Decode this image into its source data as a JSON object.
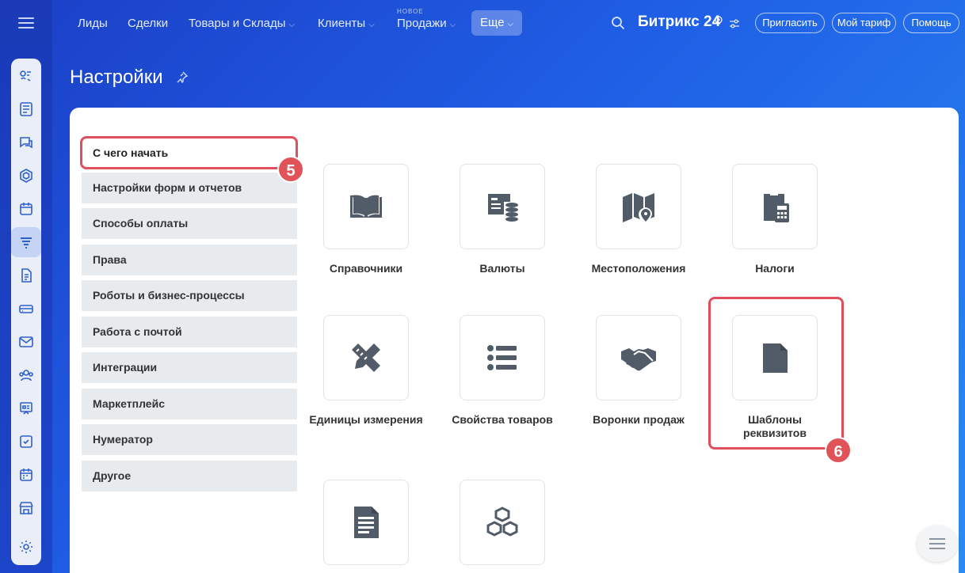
{
  "topnav": {
    "items": [
      {
        "label": "Лиды",
        "chevron": false
      },
      {
        "label": "Сделки",
        "chevron": false
      },
      {
        "label": "Товары и Склады",
        "chevron": true
      },
      {
        "label": "Клиенты",
        "chevron": true
      },
      {
        "label": "Продажи",
        "chevron": true,
        "new_label": "НОВОЕ"
      }
    ],
    "more_label": "Еще",
    "brand": "Битрикс 24",
    "invite_label": "Пригласить",
    "tariff_label": "Мой тариф",
    "help_label": "Помощь"
  },
  "page": {
    "title": "Настройки"
  },
  "settings_menu": {
    "items": [
      "С чего начать",
      "Настройки форм и отчетов",
      "Способы оплаты",
      "Права",
      "Роботы и бизнес-процессы",
      "Работа с почтой",
      "Интеграции",
      "Маркетплейс",
      "Нумератор",
      "Другое"
    ]
  },
  "tiles": [
    {
      "label": "Справочники",
      "icon": "book-icon"
    },
    {
      "label": "Валюты",
      "icon": "currency-icon"
    },
    {
      "label": "Местоположения",
      "icon": "map-icon"
    },
    {
      "label": "Налоги",
      "icon": "tax-calculator-icon"
    },
    {
      "label": "Единицы измерения",
      "icon": "ruler-pencil-icon"
    },
    {
      "label": "Свойства товаров",
      "icon": "list-icon"
    },
    {
      "label": "Воронки продаж",
      "icon": "handshake-icon"
    },
    {
      "label": "Шаблоны реквизитов",
      "icon": "document-icon"
    },
    {
      "label": "",
      "icon": "text-document-icon"
    },
    {
      "label": "",
      "icon": "cubes-icon"
    }
  ],
  "badges": {
    "step_a": "5",
    "step_b": "6"
  },
  "colors": {
    "accent_red": "#e0505c",
    "icon_gray": "#525c69"
  }
}
